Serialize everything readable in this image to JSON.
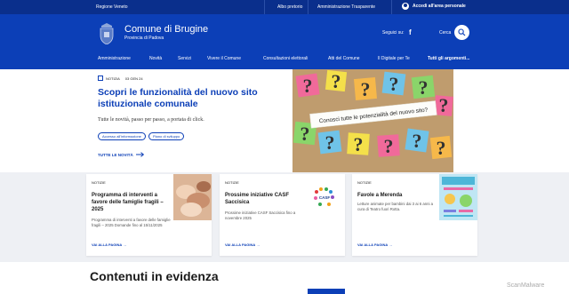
{
  "topbar": {
    "region": "Regione Veneto",
    "albo": "Albo pretorio",
    "trasparente": "Amministrazione Trasparente",
    "login": "Accedi all'area personale"
  },
  "header": {
    "town": "Comune di Brugine",
    "province": "Provincia di Padova",
    "follow": "Seguici su:",
    "search": "Cerca"
  },
  "nav": {
    "items": [
      "Amministrazione",
      "Novità",
      "Servizi",
      "Vivere il Comune",
      "Consultazioni elettorali",
      "Atti del Comune",
      "Il Digitale per Te"
    ],
    "all": "Tutti gli argomenti..."
  },
  "hero": {
    "category": "NOTIZIA",
    "date": "03 GEN 24",
    "title": "Scopri le funzionalità del nuovo sito istituzionale comunale",
    "subtitle": "Tutte le novità, passo per passo, a portata di click.",
    "tags": [
      "Accesso all'informazione",
      "Piano di sviluppo"
    ],
    "all_news": "TUTTE LE NOVITÀ",
    "image_caption": "Conosci tutte le potenzialità del nuovo sito?"
  },
  "cards": [
    {
      "category": "NOTIZIE",
      "title": "Programma di interventi a favore delle famiglie fragili – 2025",
      "description": "Programma di interventi a favore delle famiglie fragili – 2025 Domande fino al 15/11/2025",
      "more": "VAI ALLA PAGINA"
    },
    {
      "category": "NOTIZIE",
      "title": "Prossime iniziative CASF Saccisica",
      "description": "Prossime iniziative CASF Saccisica fino a novembre 2025",
      "more": "VAI ALLA PAGINA",
      "logo_text": "CASF"
    },
    {
      "category": "NOTIZIE",
      "title": "Favole a Merenda",
      "description": "Letture animate per bambini dai 3 ai 6 anni a cura di Teatro fuori Rotta.",
      "more": "VAI ALLA PAGINA"
    }
  ],
  "featured": {
    "title": "Contenuti in evidenza"
  },
  "watermark": "ScanMalware",
  "colors": {
    "primary": "#0c3fb7",
    "topbar": "#0a2f8c",
    "cards_bg": "#eef0f4"
  }
}
